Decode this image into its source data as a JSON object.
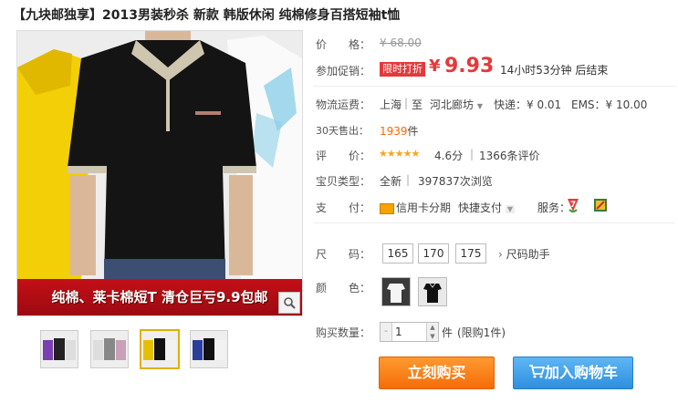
{
  "title": "【九块邮独享】2013男装秒杀 新款 韩版休闲 纯棉修身百搭短袖t恤",
  "main_image": {
    "banner_text": "纯棉、莱卡棉短T 清仓巨亏9.9包邮",
    "zoom_icon": "magnifier-icon"
  },
  "thumbnails": [
    {
      "name": "thumbnail-1",
      "colors": [
        "#7a3fb0",
        "#222",
        "#ddd"
      ]
    },
    {
      "name": "thumbnail-2",
      "colors": [
        "#ddd",
        "#888",
        "#c8a0b8"
      ]
    },
    {
      "name": "thumbnail-3",
      "colors": [
        "#e5c000",
        "#111",
        "#f2f2f2"
      ]
    },
    {
      "name": "thumbnail-4",
      "colors": [
        "#2a3f9a",
        "#111",
        "#f2f2f2"
      ]
    }
  ],
  "price_row": {
    "label": "价　　格：",
    "original": "¥ 68.00"
  },
  "promo_row": {
    "label": "参加促销：",
    "badge": "限时打折",
    "currency": "¥",
    "price": "9.93",
    "countdown": "14小时53分钟 后结束"
  },
  "shipping_row": {
    "label": "物流运费：",
    "from": "上海",
    "divider": "|",
    "to_prefix": "至",
    "to": "河北廊坊",
    "express": "快递：¥ 0.01",
    "ems": "EMS：¥ 10.00"
  },
  "sold_row": {
    "label": "30天售出：",
    "count": "1939",
    "unit": "件"
  },
  "rating_row": {
    "label": "评　　价：",
    "stars": "★★★★★",
    "score": "4.6分",
    "divider": "|",
    "reviews": "1366条评价"
  },
  "type_row": {
    "label": "宝贝类型：",
    "type": "全新",
    "divider": "|",
    "views": "397837次浏览"
  },
  "payment_row": {
    "label": "支　　付：",
    "credit": "信用卡分期",
    "quickpay": "快捷支付",
    "service_label": "服务："
  },
  "size_row": {
    "label": "尺　　码：",
    "sizes": [
      "165",
      "170",
      "175"
    ],
    "helper": "尺码助手"
  },
  "color_row": {
    "label": "颜　　色："
  },
  "qty_row": {
    "label": "购买数量：",
    "value": "1",
    "unit": "件",
    "limit": "(限购1件)"
  },
  "buttons": {
    "buy": "立刻购买",
    "cart": "加入购物车"
  },
  "colors": {
    "accent_red": "#e4393c",
    "buy_orange": "#f56c08",
    "cart_blue": "#2e8fde"
  }
}
